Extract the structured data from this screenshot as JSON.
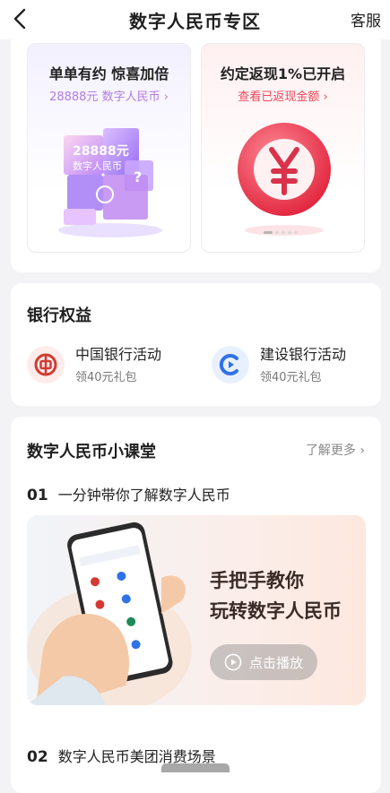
{
  "header": {
    "title": "数字人民币专区",
    "service_label": "客服"
  },
  "promos": [
    {
      "title": "单单有约 惊喜加倍",
      "subtitle": "28888元 数字人民币 ›",
      "art_line1": "28888元",
      "art_line2": "数字人民币"
    },
    {
      "title": "约定返现1%已开启",
      "subtitle": "查看已返现金额 ›"
    }
  ],
  "bank": {
    "title": "银行权益",
    "items": [
      {
        "name": "中国银行活动",
        "gift": "领40元礼包",
        "icon": "bank-of-china-icon"
      },
      {
        "name": "建设银行活动",
        "gift": "领40元礼包",
        "icon": "ccb-icon"
      }
    ]
  },
  "classroom": {
    "title": "数字人民币小课堂",
    "more_label": "了解更多 ›",
    "lessons": [
      {
        "num": "01",
        "title": "一分钟带你了解数字人民币"
      },
      {
        "num": "02",
        "title": "数字人民币美团消费场景"
      }
    ],
    "banner": {
      "line1": "手把手教你",
      "line2": "玩转数字人民币",
      "play_label": "点击播放"
    }
  },
  "colors": {
    "promo_left_accent": "#b27be0",
    "promo_right_accent": "#f0465a",
    "boc_red": "#d23a32",
    "ccb_blue": "#2f72e8"
  }
}
